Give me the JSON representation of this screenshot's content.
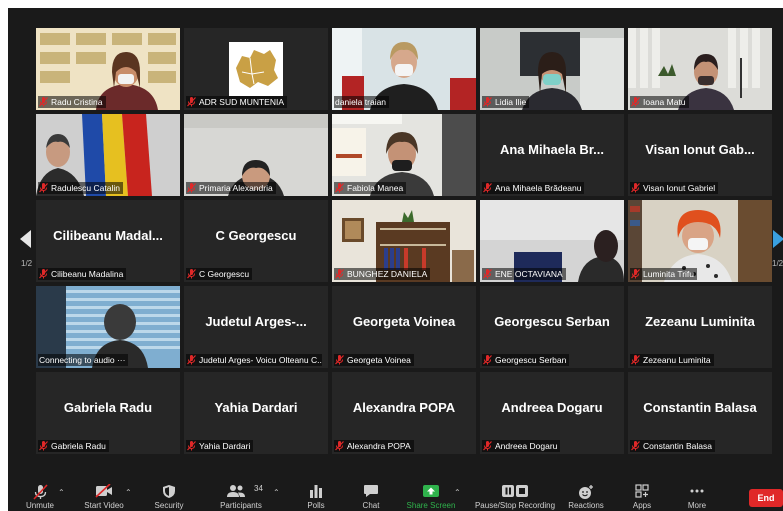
{
  "gallery": {
    "page_left": "1/2",
    "page_right": "1/2",
    "tiles": [
      {
        "label": "Radu Cristina",
        "big": ""
      },
      {
        "label": "ADR SUD MUNTENIA",
        "big": ""
      },
      {
        "label": "daniela traian",
        "big": ""
      },
      {
        "label": "Lidia Ilie",
        "big": ""
      },
      {
        "label": "Ioana Matu",
        "big": ""
      },
      {
        "label": "Radulescu Catalin",
        "big": ""
      },
      {
        "label": "Primaria Alexandria",
        "big": ""
      },
      {
        "label": "Fabiola Manea",
        "big": ""
      },
      {
        "label": "Ana Mihaela Brădeanu",
        "big": "Ana Mihaela Br..."
      },
      {
        "label": "Visan Ionut Gabriel",
        "big": "Visan Ionut Gab..."
      },
      {
        "label": "Cilibeanu Madalina",
        "big": "Cilibeanu Madal..."
      },
      {
        "label": "C Georgescu",
        "big": "C Georgescu"
      },
      {
        "label": "BUNGHEZ DANIELA",
        "big": ""
      },
      {
        "label": "ENE OCTAVIANA",
        "big": ""
      },
      {
        "label": "Luminita Trifu",
        "big": ""
      },
      {
        "label": "Connecting to audio ···",
        "big": ""
      },
      {
        "label": "Judetul Arges- Voicu Olteanu C...",
        "big": "Judetul Arges-..."
      },
      {
        "label": "Georgeta Voinea",
        "big": "Georgeta Voinea"
      },
      {
        "label": "Georgescu Serban",
        "big": "Georgescu Serban"
      },
      {
        "label": "Zezeanu Luminita",
        "big": "Zezeanu Luminita"
      },
      {
        "label": "Gabriela Radu",
        "big": "Gabriela Radu"
      },
      {
        "label": "Yahia Dardari",
        "big": "Yahia Dardari"
      },
      {
        "label": "Alexandra POPA",
        "big": "Alexandra POPA"
      },
      {
        "label": "Andreea Dogaru",
        "big": "Andreea Dogaru"
      },
      {
        "label": "Constantin Balasa",
        "big": "Constantin Balasa"
      }
    ]
  },
  "toolbar": {
    "unmute": "Unmute",
    "start_video": "Start Video",
    "security": "Security",
    "participants": "Participants",
    "participants_count": "34",
    "polls": "Polls",
    "chat": "Chat",
    "share_screen": "Share Screen",
    "recording": "Pause/Stop Recording",
    "reactions": "Reactions",
    "apps": "Apps",
    "more": "More",
    "end": "End"
  },
  "colors": {
    "active_speaker": "#d9c84a",
    "share_green": "#2fb24c",
    "end_red": "#e02828",
    "muted_red": "#e02828"
  }
}
